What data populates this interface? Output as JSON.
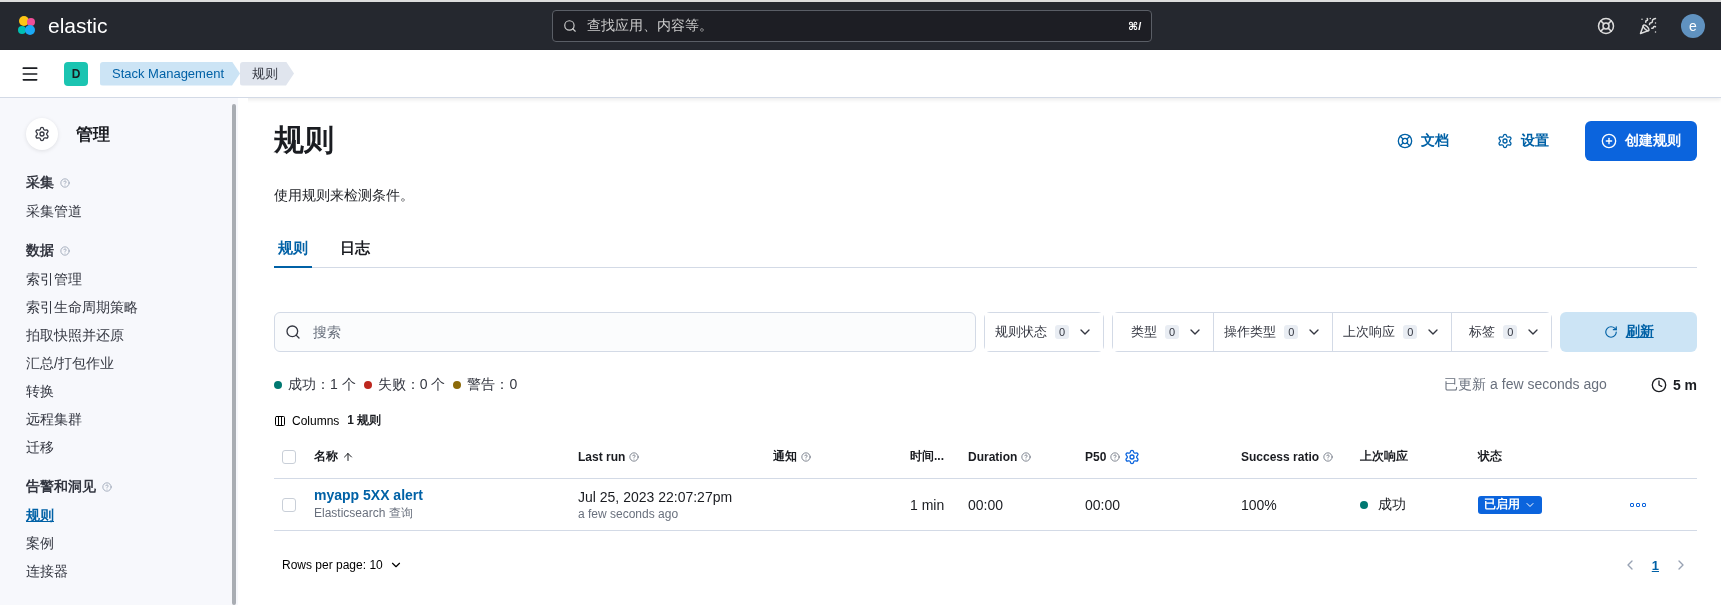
{
  "header": {
    "logo_text": "elastic",
    "search_placeholder": "查找应用、内容等。",
    "shortcut": "⌘/",
    "avatar": "e"
  },
  "breadcrumbs": {
    "space": "D",
    "items": [
      {
        "label": "Stack Management",
        "selected": false
      },
      {
        "label": "规则",
        "selected": true
      }
    ]
  },
  "sidebar": {
    "title": "管理",
    "groups": [
      {
        "title": "采集",
        "items": [
          {
            "label": "采集管道",
            "selected": false
          }
        ]
      },
      {
        "title": "数据",
        "items": [
          {
            "label": "索引管理",
            "selected": false
          },
          {
            "label": "索引生命周期策略",
            "selected": false
          },
          {
            "label": "拍取快照并还原",
            "selected": false
          },
          {
            "label": "汇总/打包作业",
            "selected": false
          },
          {
            "label": "转换",
            "selected": false
          },
          {
            "label": "远程集群",
            "selected": false
          },
          {
            "label": "迁移",
            "selected": false
          }
        ]
      },
      {
        "title": "告警和洞见",
        "items": [
          {
            "label": "规则",
            "selected": true
          },
          {
            "label": "案例",
            "selected": false
          },
          {
            "label": "连接器",
            "selected": false
          }
        ]
      }
    ]
  },
  "page": {
    "title": "规则",
    "description": "使用规则来检测条件。",
    "actions": [
      {
        "kind": "link",
        "label": "文档"
      },
      {
        "kind": "link",
        "label": "设置"
      },
      {
        "kind": "primary",
        "label": "创建规则"
      }
    ]
  },
  "tabs": [
    {
      "label": "规则",
      "selected": true
    },
    {
      "label": "日志",
      "selected": false
    }
  ],
  "toolbar": {
    "search_placeholder": "搜索",
    "filters": [
      {
        "label": "规则状态",
        "count": "0"
      },
      {
        "label": "类型",
        "count": "0"
      },
      {
        "label": "操作类型",
        "count": "0"
      },
      {
        "label": "上次响应",
        "count": "0"
      },
      {
        "label": "标签",
        "count": "0"
      }
    ],
    "refresh": "刷新"
  },
  "summary": [
    {
      "label": "成功：1 个",
      "color": "#007871"
    },
    {
      "label": "失败：0 个",
      "color": "#bd271e"
    },
    {
      "label": "警告：0",
      "color": "#8c6a09"
    }
  ],
  "updated": "已更新 a few seconds ago",
  "interval": "5 m",
  "columns_button": "Columns",
  "rule_count": "1 规则",
  "table": {
    "select_all_checked": false,
    "columns": [
      {
        "label": "名称",
        "info": false,
        "sorted": true
      },
      {
        "label": "Last run",
        "info": true,
        "sorted": false
      },
      {
        "label": "通知",
        "info": true,
        "sorted": false
      },
      {
        "label": "时间...",
        "info": false,
        "sorted": false
      },
      {
        "label": "Duration",
        "info": true,
        "sorted": false
      },
      {
        "label": "P50",
        "info": true,
        "sorted": false
      },
      {
        "label": "Success ratio",
        "info": true,
        "sorted": false
      },
      {
        "label": "上次响应",
        "info": false,
        "sorted": false
      },
      {
        "label": "状态",
        "info": false,
        "sorted": false
      }
    ],
    "rows": [
      {
        "checked": false,
        "name": "myapp 5XX alert",
        "type": "Elasticsearch 查询",
        "last_run": "Jul 25, 2023 22:07:27pm",
        "last_run_relative": "a few seconds ago",
        "interval": "1 min",
        "duration": "00:00",
        "p50": "00:00",
        "success_ratio": "100%",
        "last_response": "成功",
        "status": "已启用"
      }
    ]
  },
  "pagination": {
    "rows_per_page": "Rows per page: 10",
    "pages": [
      {
        "label": "1",
        "selected": true
      }
    ]
  }
}
